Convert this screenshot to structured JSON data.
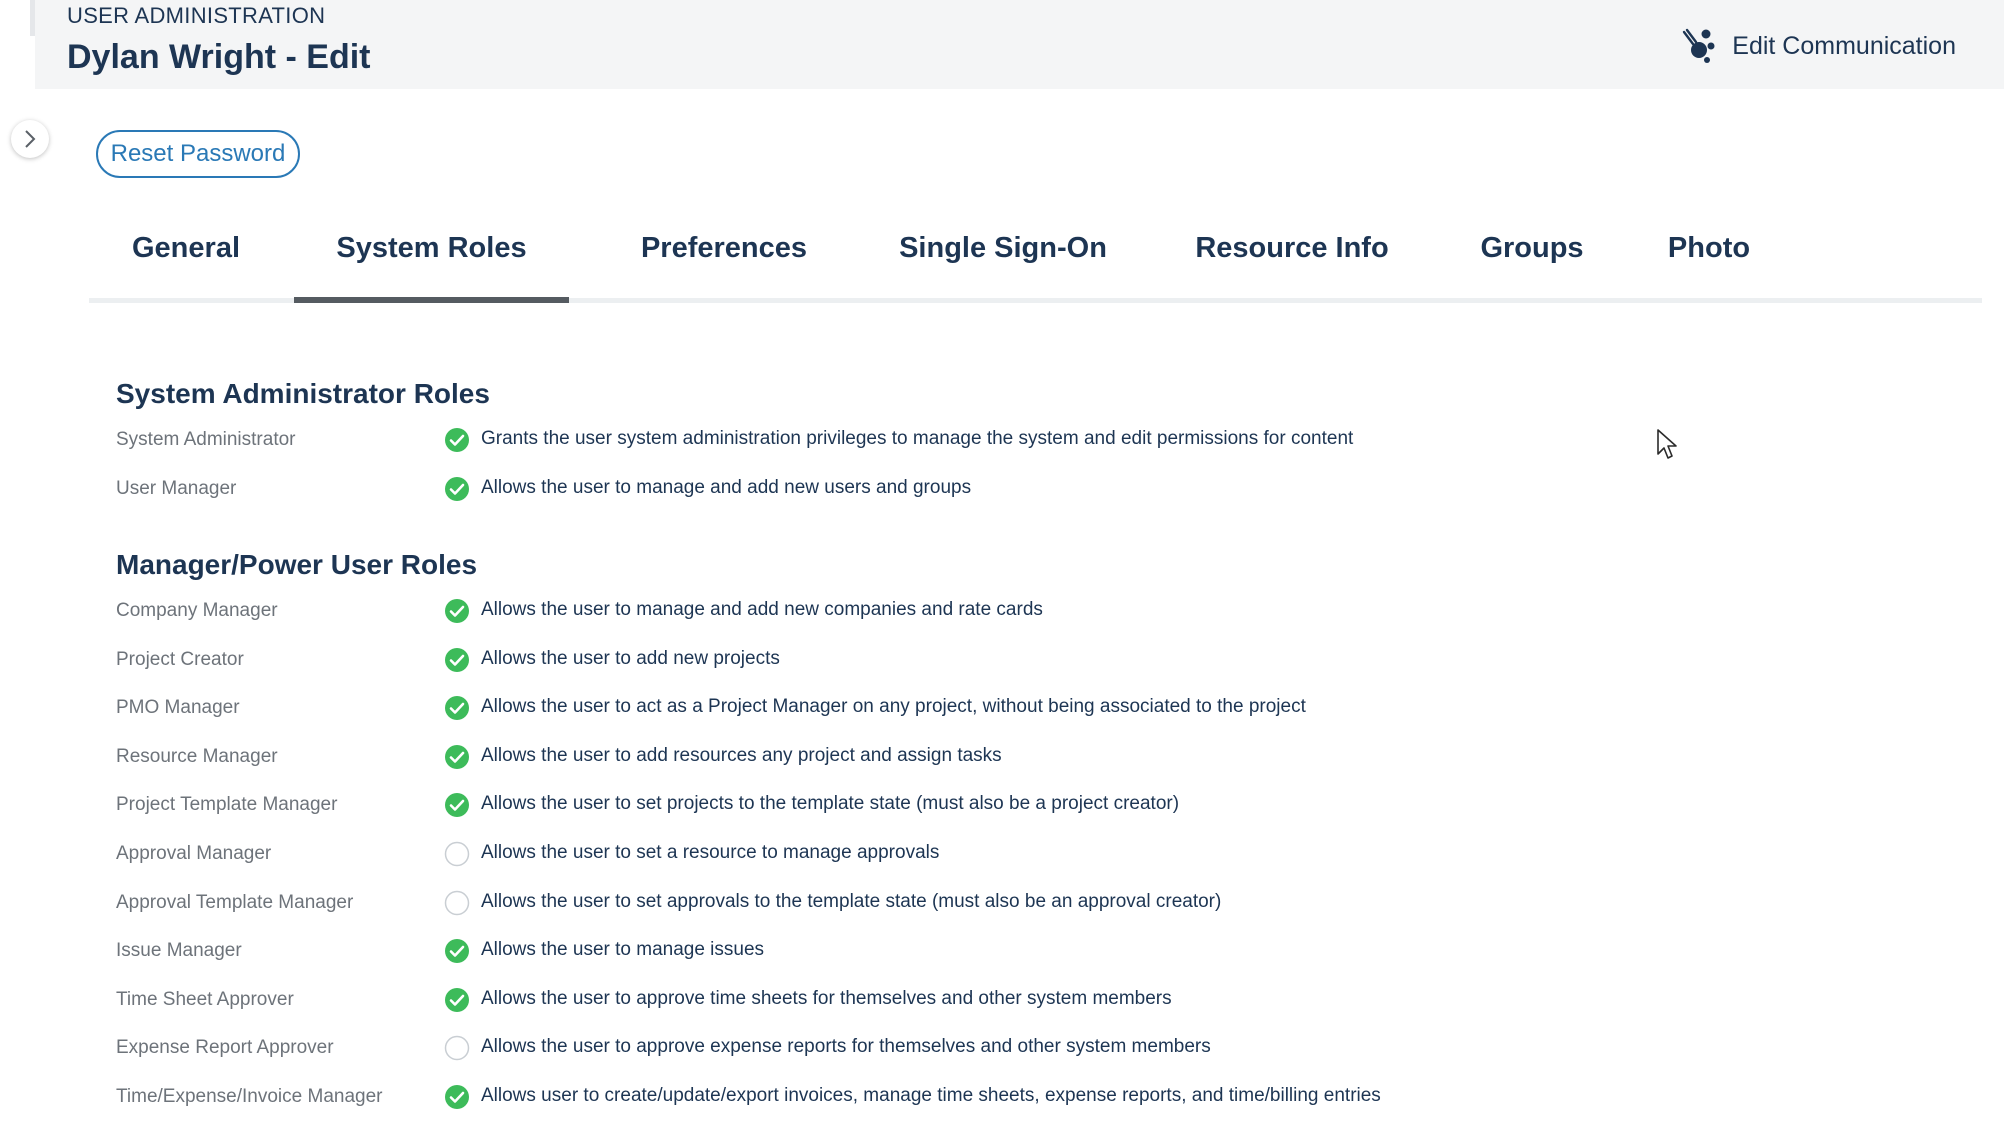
{
  "header": {
    "eyebrow": "USER ADMINISTRATION",
    "title": "Dylan Wright - Edit",
    "edit_communication_label": "Edit Communication",
    "edit_communication_icon": "communication-icon"
  },
  "sidebar_toggle": {
    "icon": "chevron-right-icon"
  },
  "reset_password_label": "Reset Password",
  "tabs": [
    {
      "label": "General",
      "active": false
    },
    {
      "label": "System Roles",
      "active": true
    },
    {
      "label": "Preferences",
      "active": false
    },
    {
      "label": "Single Sign-On",
      "active": false
    },
    {
      "label": "Resource Info",
      "active": false
    },
    {
      "label": "Groups",
      "active": false
    },
    {
      "label": "Photo",
      "active": false
    }
  ],
  "sections": [
    {
      "title": "System Administrator Roles",
      "roles": [
        {
          "name": "System Administrator",
          "checked": true,
          "description": "Grants the user system administration privileges to manage the system and edit permissions for content"
        },
        {
          "name": "User Manager",
          "checked": true,
          "description": "Allows the user to manage and add new users and groups"
        }
      ]
    },
    {
      "title": "Manager/Power User Roles",
      "roles": [
        {
          "name": "Company Manager",
          "checked": true,
          "description": "Allows the user to manage and add new companies and rate cards"
        },
        {
          "name": "Project Creator",
          "checked": true,
          "description": "Allows the user to add new projects"
        },
        {
          "name": "PMO Manager",
          "checked": true,
          "description": "Allows the user to act as a Project Manager on any project, without being associated to the project"
        },
        {
          "name": "Resource Manager",
          "checked": true,
          "description": "Allows the user to add resources any project and assign tasks"
        },
        {
          "name": "Project Template Manager",
          "checked": true,
          "description": "Allows the user to set projects to the template state (must also be a project creator)"
        },
        {
          "name": "Approval Manager",
          "checked": false,
          "description": "Allows the user to set a resource to manage approvals"
        },
        {
          "name": "Approval Template Manager",
          "checked": false,
          "description": "Allows the user to set approvals to the template state (must also be an approval creator)"
        },
        {
          "name": "Issue Manager",
          "checked": true,
          "description": "Allows the user to manage issues"
        },
        {
          "name": "Time Sheet Approver",
          "checked": true,
          "description": "Allows the user to approve time sheets for themselves and other system members"
        },
        {
          "name": "Expense Report Approver",
          "checked": false,
          "description": "Allows the user to approve expense reports for themselves and other system members"
        },
        {
          "name": "Time/Expense/Invoice Manager",
          "checked": true,
          "description": "Allows user to create/update/export invoices, manage time sheets, expense reports, and time/billing entries"
        }
      ]
    }
  ],
  "colors": {
    "check_on": "#3dbb5a",
    "check_off_border": "#c9ced3",
    "accent": "#2a79b6",
    "heading": "#1d3553"
  }
}
